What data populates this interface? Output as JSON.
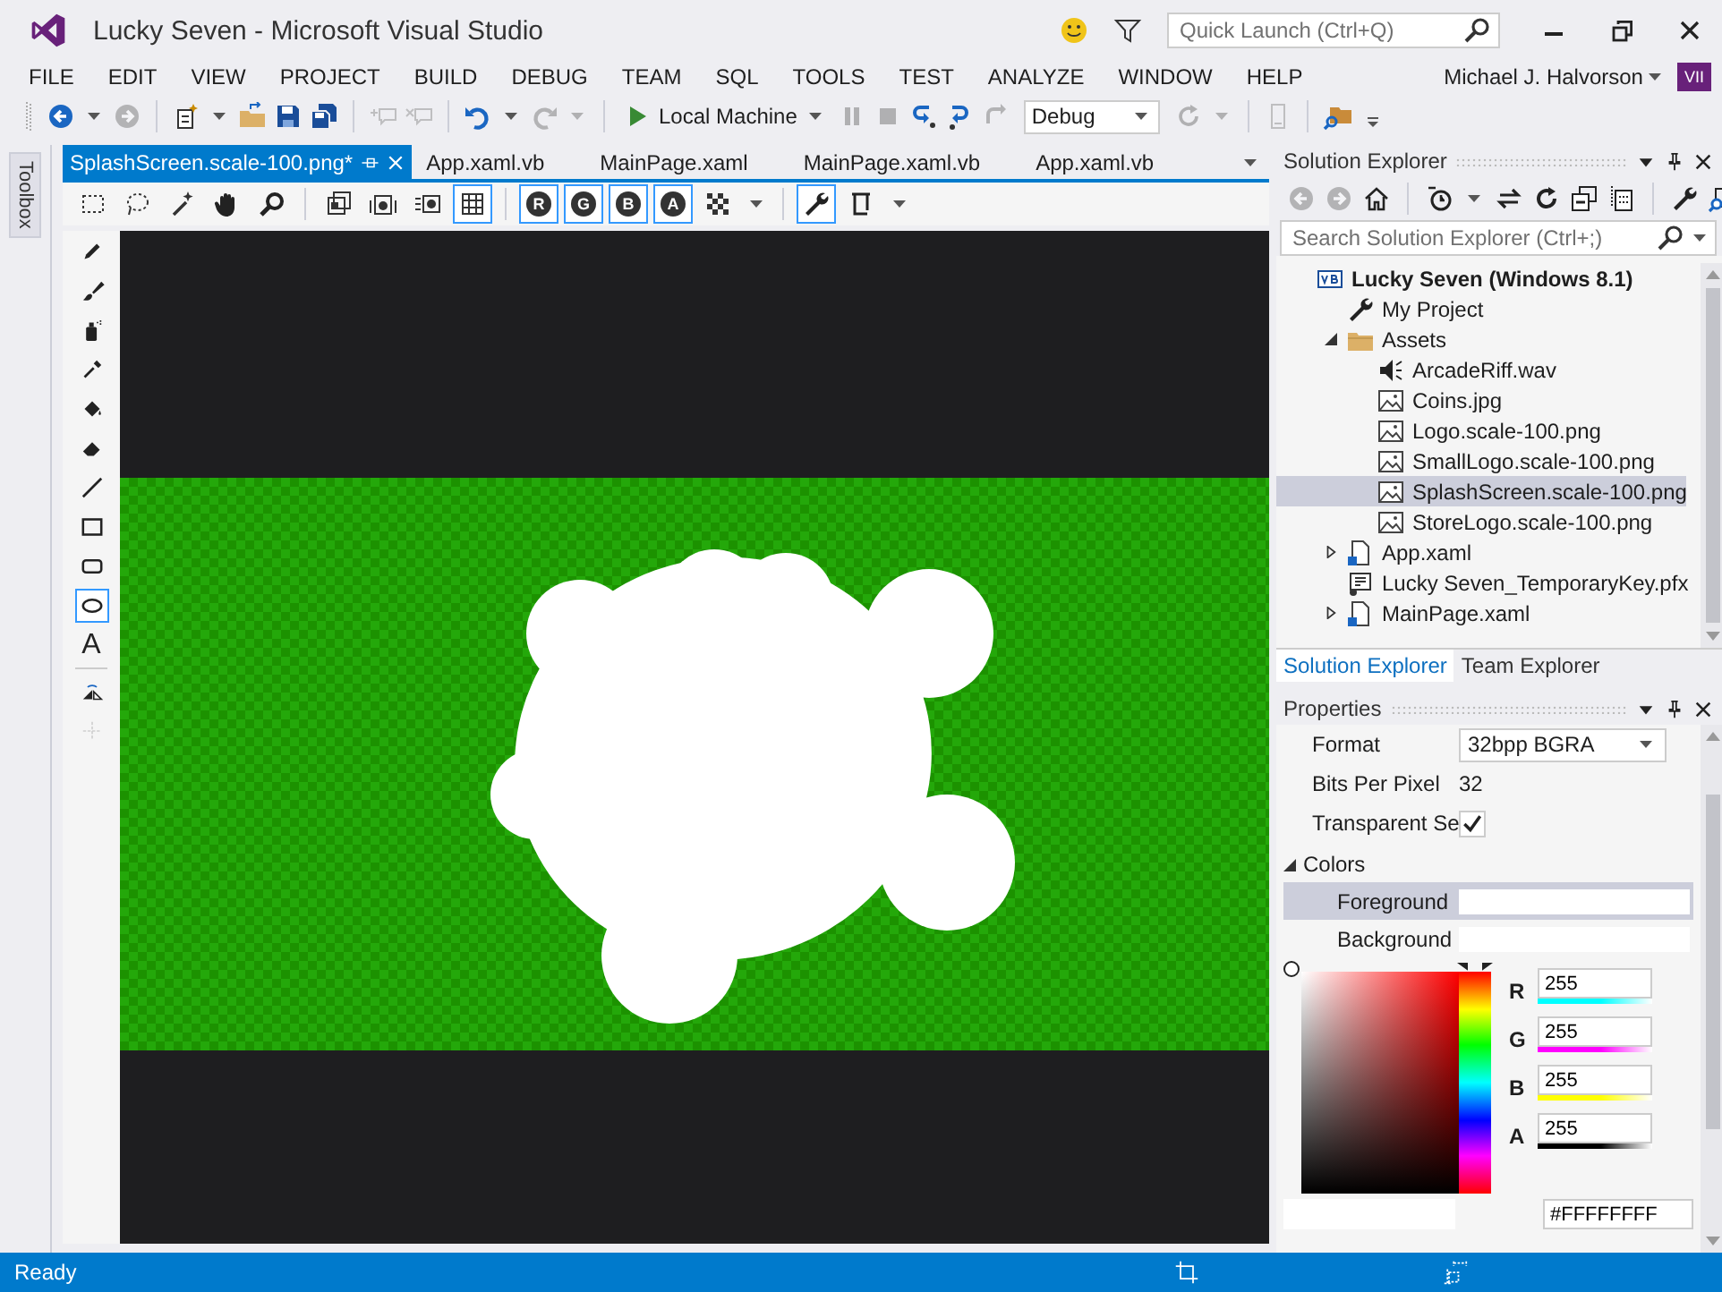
{
  "window": {
    "title": "Lucky Seven - Microsoft Visual Studio",
    "quick_launch": {
      "placeholder": "Quick Launch (Ctrl+Q)"
    },
    "user": "Michael J. Halvorson",
    "user_badge": "VII"
  },
  "menu": [
    "FILE",
    "EDIT",
    "VIEW",
    "PROJECT",
    "BUILD",
    "DEBUG",
    "TEAM",
    "SQL",
    "TOOLS",
    "TEST",
    "ANALYZE",
    "WINDOW",
    "HELP"
  ],
  "toolbar": [
    {
      "kind": "back",
      "disabled": false
    },
    {
      "kind": "caret",
      "disabled": false
    },
    {
      "kind": "forward",
      "disabled": true
    },
    {
      "kind": "separator"
    },
    {
      "kind": "newproj",
      "disabled": false
    },
    {
      "kind": "caret",
      "disabled": false
    },
    {
      "kind": "open",
      "disabled": false
    },
    {
      "kind": "save",
      "disabled": false
    },
    {
      "kind": "saveall",
      "disabled": false
    },
    {
      "kind": "separator"
    },
    {
      "kind": "comment",
      "disabled": true
    },
    {
      "kind": "uncomment",
      "disabled": true
    },
    {
      "kind": "separator"
    },
    {
      "kind": "undo",
      "disabled": false
    },
    {
      "kind": "caret",
      "disabled": false
    },
    {
      "kind": "redo",
      "disabled": true
    },
    {
      "kind": "caret",
      "disabled": true
    },
    {
      "kind": "separator"
    },
    {
      "kind": "run",
      "label": "Local Machine"
    },
    {
      "kind": "pause",
      "disabled": true
    },
    {
      "kind": "stop",
      "disabled": true
    },
    {
      "kind": "stepin",
      "disabled": false
    },
    {
      "kind": "stepover",
      "disabled": false
    },
    {
      "kind": "stepout",
      "disabled": true
    },
    {
      "kind": "combo",
      "value": "Debug"
    },
    {
      "kind": "refresh",
      "disabled": true
    },
    {
      "kind": "caret",
      "disabled": true
    },
    {
      "kind": "separator"
    },
    {
      "kind": "device",
      "disabled": true
    },
    {
      "kind": "separator"
    },
    {
      "kind": "findfolder",
      "disabled": false
    },
    {
      "kind": "overflow",
      "disabled": false
    }
  ],
  "document_tabs": [
    {
      "label": "SplashScreen.scale-100.png*",
      "selected": true
    },
    {
      "label": "App.xaml.vb",
      "selected": false
    },
    {
      "label": "MainPage.xaml",
      "selected": false
    },
    {
      "label": "MainPage.xaml.vb",
      "selected": false
    },
    {
      "label": "App.xaml.vb",
      "selected": false
    }
  ],
  "image_toolbar": [
    {
      "kind": "rectsel",
      "on": false
    },
    {
      "kind": "lasso",
      "on": false
    },
    {
      "kind": "wand",
      "on": false
    },
    {
      "kind": "hand",
      "on": false
    },
    {
      "kind": "zoom",
      "on": false
    },
    {
      "kind": "separator"
    },
    {
      "kind": "frame",
      "on": false
    },
    {
      "kind": "frames",
      "on": false
    },
    {
      "kind": "framelist",
      "on": false
    },
    {
      "kind": "grid",
      "on": true
    },
    {
      "kind": "separator"
    },
    {
      "kind": "channel",
      "label": "R",
      "on": true
    },
    {
      "kind": "channel",
      "label": "G",
      "on": true
    },
    {
      "kind": "channel",
      "label": "B",
      "on": true
    },
    {
      "kind": "channel",
      "label": "A",
      "on": true
    },
    {
      "kind": "checker",
      "on": false
    },
    {
      "kind": "caret",
      "on": false
    },
    {
      "kind": "separator"
    },
    {
      "kind": "wrench",
      "on": true
    },
    {
      "kind": "export",
      "on": false
    },
    {
      "kind": "caret",
      "on": false
    }
  ],
  "tool_palette": [
    {
      "kind": "pencil",
      "selected": false,
      "disabled": false
    },
    {
      "kind": "brush",
      "selected": false,
      "disabled": false
    },
    {
      "kind": "airbrush",
      "selected": false,
      "disabled": false
    },
    {
      "kind": "dropper",
      "selected": false,
      "disabled": false
    },
    {
      "kind": "fill",
      "selected": false,
      "disabled": false
    },
    {
      "kind": "eraser",
      "selected": false,
      "disabled": false
    },
    {
      "kind": "line",
      "selected": false,
      "disabled": false
    },
    {
      "kind": "rect",
      "selected": false,
      "disabled": false
    },
    {
      "kind": "rrect",
      "selected": false,
      "disabled": false
    },
    {
      "kind": "ellipse",
      "selected": true,
      "disabled": false
    },
    {
      "kind": "glyph",
      "label": "A",
      "selected": false,
      "disabled": false
    },
    {
      "kind": "separator"
    },
    {
      "kind": "rotate",
      "selected": false,
      "disabled": false
    },
    {
      "kind": "crop",
      "selected": false,
      "disabled": true
    }
  ],
  "toolbox_label": "Toolbox",
  "solution_explorer": {
    "title": "Solution Explorer",
    "toolbar": [
      {
        "kind": "back",
        "disabled": true
      },
      {
        "kind": "forward",
        "disabled": true
      },
      {
        "kind": "home",
        "disabled": false
      },
      {
        "kind": "separator"
      },
      {
        "kind": "history",
        "disabled": false
      },
      {
        "kind": "caret",
        "disabled": false
      },
      {
        "kind": "sync",
        "disabled": false
      },
      {
        "kind": "refresh2",
        "disabled": false
      },
      {
        "kind": "collapse",
        "disabled": false
      },
      {
        "kind": "showall",
        "disabled": false
      },
      {
        "kind": "separator"
      },
      {
        "kind": "wrench",
        "disabled": false
      },
      {
        "kind": "preview",
        "disabled": false
      }
    ],
    "search": {
      "placeholder": "Search Solution Explorer (Ctrl+;)"
    },
    "tree": [
      {
        "label": "Lucky Seven (Windows 8.1)",
        "kind": "vb",
        "selected": false,
        "children": [
          {
            "label": "My Project",
            "kind": "wrench",
            "selected": false
          },
          {
            "label": "Assets",
            "kind": "folder",
            "selected": false,
            "expanded": true,
            "children": [
              {
                "label": "ArcadeRiff.wav",
                "kind": "audio",
                "selected": false
              },
              {
                "label": "Coins.jpg",
                "kind": "image",
                "selected": false
              },
              {
                "label": "Logo.scale-100.png",
                "kind": "image",
                "selected": false
              },
              {
                "label": "SmallLogo.scale-100.png",
                "kind": "image",
                "selected": false
              },
              {
                "label": "SplashScreen.scale-100.png",
                "kind": "image",
                "selected": true
              },
              {
                "label": "StoreLogo.scale-100.png",
                "kind": "image",
                "selected": false
              }
            ]
          },
          {
            "label": "App.xaml",
            "kind": "xaml",
            "selected": false,
            "expanded": false
          },
          {
            "label": "Lucky Seven_TemporaryKey.pfx",
            "kind": "key",
            "selected": false
          },
          {
            "label": "MainPage.xaml",
            "kind": "xaml",
            "selected": false,
            "expanded": false
          }
        ]
      }
    ],
    "tabs": [
      {
        "label": "Solution Explorer",
        "selected": true
      },
      {
        "label": "Team Explorer",
        "selected": false
      }
    ]
  },
  "properties": {
    "title": "Properties",
    "rows": [
      {
        "kind": "dropdown",
        "label": "Format",
        "value": "32bpp BGRA"
      },
      {
        "kind": "text",
        "label": "Bits Per Pixel",
        "value": "32"
      },
      {
        "kind": "checkbox",
        "label": "Transparent Se",
        "checked": true
      }
    ],
    "colors": {
      "label": "Colors",
      "expanded": true,
      "items": [
        {
          "label": "Foreground",
          "selected": true
        },
        {
          "label": "Background",
          "selected": false
        }
      ],
      "hue_slider": {
        "level": 0
      },
      "channels": [
        {
          "label": "R",
          "value": "255",
          "color": "#00ffff"
        },
        {
          "label": "G",
          "value": "255",
          "color": "#ff00ff"
        },
        {
          "label": "B",
          "value": "255",
          "color": "#ffff00"
        },
        {
          "label": "A",
          "value": "255",
          "color": "#000000"
        }
      ],
      "hex": "#FFFFFFFF"
    }
  },
  "status_bar": {
    "text": "Ready"
  }
}
